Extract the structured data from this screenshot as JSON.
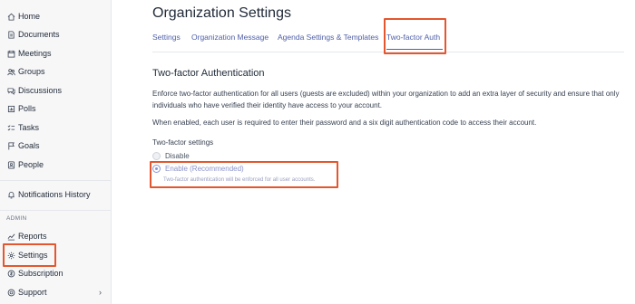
{
  "sidebar": {
    "items": [
      {
        "label": "Home",
        "icon": "home-icon"
      },
      {
        "label": "Documents",
        "icon": "document-icon"
      },
      {
        "label": "Meetings",
        "icon": "calendar-icon"
      },
      {
        "label": "Groups",
        "icon": "group-icon"
      },
      {
        "label": "Discussions",
        "icon": "chat-icon"
      },
      {
        "label": "Polls",
        "icon": "poll-icon"
      },
      {
        "label": "Tasks",
        "icon": "tasks-icon"
      },
      {
        "label": "Goals",
        "icon": "flag-icon"
      },
      {
        "label": "People",
        "icon": "person-icon"
      }
    ],
    "notifications": {
      "label": "Notifications History",
      "icon": "bell-icon"
    },
    "admin_label": "ADMIN",
    "admin_items": [
      {
        "label": "Reports",
        "icon": "chart-icon"
      },
      {
        "label": "Settings",
        "icon": "gear-icon"
      },
      {
        "label": "Subscription",
        "icon": "subscription-icon"
      },
      {
        "label": "Support",
        "icon": "support-icon"
      }
    ]
  },
  "main": {
    "title": "Organization Settings",
    "tabs": [
      {
        "label": "Settings"
      },
      {
        "label": "Organization Message"
      },
      {
        "label": "Agenda Settings & Templates"
      },
      {
        "label": "Two-factor Auth"
      }
    ],
    "section_title": "Two-factor Authentication",
    "para1": "Enforce two-factor authentication for all users (guests are excluded) within your organization to add an extra layer of security and ensure that only individuals who have verified their identity have access to your account.",
    "para2": "When enabled, each user is required to enter their password and a six digit authentication code to access their account.",
    "settings_label": "Two-factor settings",
    "options": [
      {
        "label": "Disable",
        "selected": false
      },
      {
        "label": "Enable (Recommended)",
        "selected": true,
        "help": "Two-factor authentication will be enforced for all user accounts."
      }
    ]
  },
  "colors": {
    "accent": "#4f5fa8",
    "highlight": "#e4572e"
  }
}
